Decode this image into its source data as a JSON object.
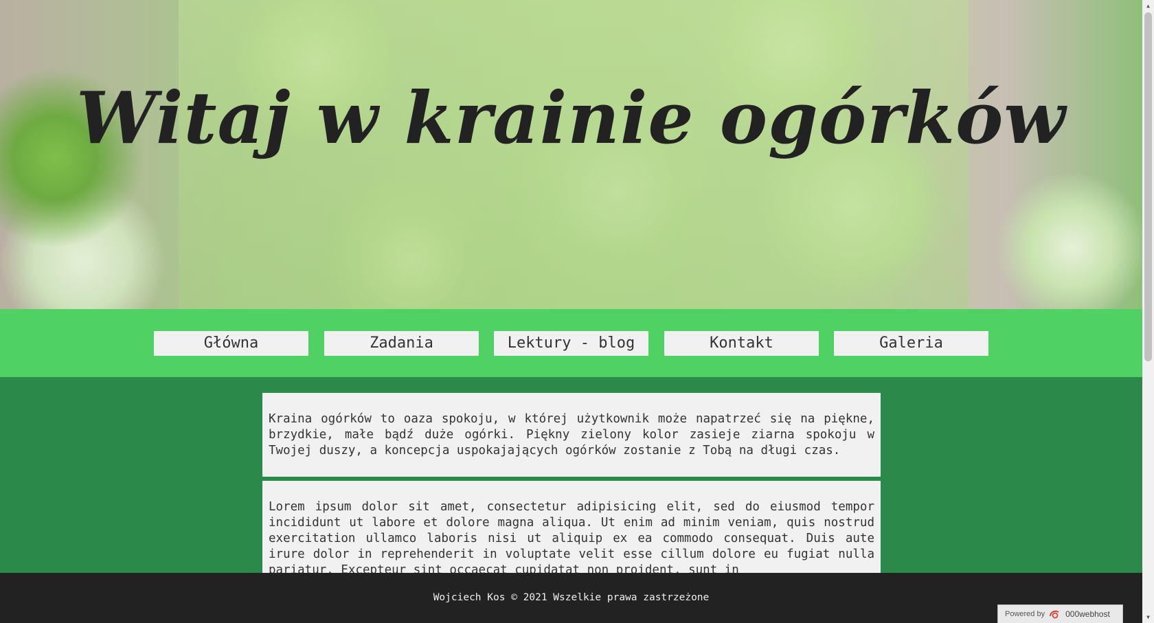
{
  "hero": {
    "title": "Witaj w krainie ogórków"
  },
  "nav": {
    "items": [
      {
        "label": "Główna"
      },
      {
        "label": "Zadania"
      },
      {
        "label": "Lektury - blog"
      },
      {
        "label": "Kontakt"
      },
      {
        "label": "Galeria"
      }
    ]
  },
  "content": {
    "paragraph_1": "Kraina ogórków to oaza spokoju, w której użytkownik może napatrzeć się na piękne, brzydkie, małe bądź duże ogórki. Piękny zielony kolor zasieje ziarna spokoju w Twojej duszy, a koncepcja uspokajających ogórków zostanie z Tobą na długi czas.",
    "paragraph_2": "Lorem ipsum dolor sit amet, consectetur adipisicing elit, sed do eiusmod tempor incididunt ut labore et dolore magna aliqua. Ut enim ad minim veniam, quis nostrud exercitation ullamco laboris nisi ut aliquip ex ea commodo consequat. Duis aute irure dolor in reprehenderit in voluptate velit esse cillum dolore eu fugiat nulla pariatur. Excepteur sint occaecat cupidatat non proident, sunt in"
  },
  "footer": {
    "text": "Wojciech Kos © 2021 Wszelkie prawa zastrzeżone"
  },
  "badge": {
    "powered_by": "Powered by",
    "brand": "000webhost",
    "logo_icon": "000webhost-logo-icon"
  },
  "colors": {
    "nav_bg": "#4fd163",
    "content_bg": "#2b8a4a",
    "card_bg": "#f1f1f1",
    "footer_bg": "#222222"
  }
}
